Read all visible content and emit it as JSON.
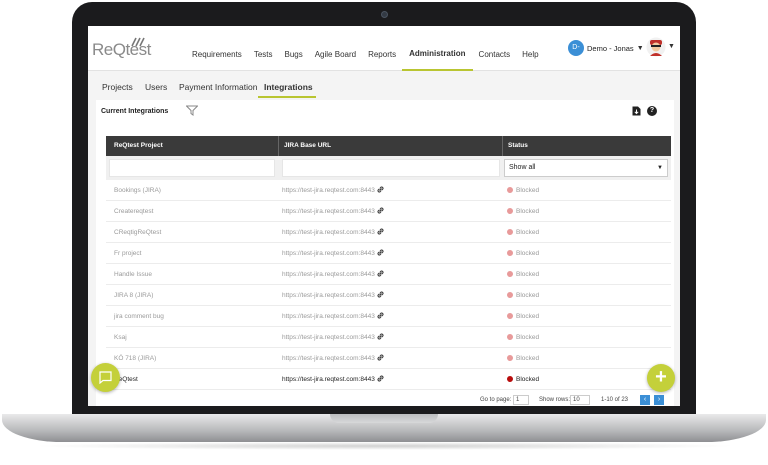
{
  "brand": {
    "logo_text": "ReQtest"
  },
  "nav": {
    "items": [
      "Requirements",
      "Tests",
      "Bugs",
      "Agile Board",
      "Reports",
      "Administration",
      "Contacts",
      "Help"
    ],
    "active": "Administration"
  },
  "user": {
    "initials": "D-",
    "name": "Demo - Jonas"
  },
  "subtabs": {
    "items": [
      "Projects",
      "Users",
      "Payment Information",
      "Integrations"
    ],
    "active": "Integrations"
  },
  "panel": {
    "title": "Current Integrations"
  },
  "table": {
    "headers": {
      "project": "ReQtest Project",
      "url": "JIRA Base URL",
      "status": "Status"
    },
    "status_filter": "Show all",
    "rows": [
      {
        "project": "Bookings (JIRA)",
        "url": "https://test-jira.reqtest.com:8443",
        "status": "Blocked"
      },
      {
        "project": "Createreqtest",
        "url": "https://test-jira.reqtest.com:8443",
        "status": "Blocked"
      },
      {
        "project": "CReqtigReQtest",
        "url": "https://test-jira.reqtest.com:8443",
        "status": "Blocked"
      },
      {
        "project": "Fr project",
        "url": "https://test-jira.reqtest.com:8443",
        "status": "Blocked"
      },
      {
        "project": "Handle Issue",
        "url": "https://test-jira.reqtest.com:8443",
        "status": "Blocked"
      },
      {
        "project": "JIRA 8 (JIRA)",
        "url": "https://test-jira.reqtest.com:8443",
        "status": "Blocked"
      },
      {
        "project": "jira comment bug",
        "url": "https://test-jira.reqtest.com:8443",
        "status": "Blocked"
      },
      {
        "project": "Ksaj",
        "url": "https://test-jira.reqtest.com:8443",
        "status": "Blocked"
      },
      {
        "project": "KÖ 718 (JIRA)",
        "url": "https://test-jira.reqtest.com:8443",
        "status": "Blocked"
      },
      {
        "project": "ReQtest",
        "url": "https://test-jira.reqtest.com:8443",
        "status": "Blocked"
      }
    ]
  },
  "pager": {
    "goto_label": "Go to page:",
    "goto_value": "1",
    "rows_label": "Show rows:",
    "rows_value": "10",
    "range": "1-10 of 23",
    "prev": "‹",
    "next": "›"
  },
  "fab": {
    "label": "+"
  },
  "colors": {
    "accent": "#c4d03a",
    "blue": "#3b8fd6",
    "blocked": "#e89a9a",
    "blocked_active": "#b80d0d"
  }
}
